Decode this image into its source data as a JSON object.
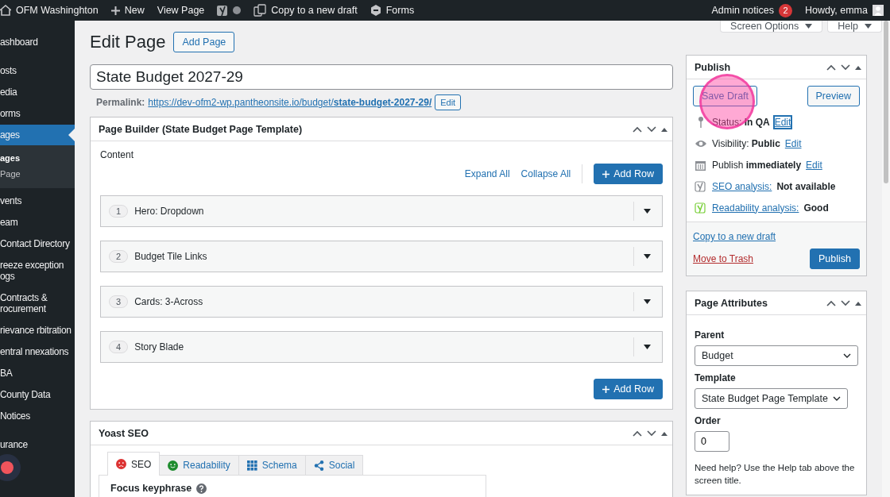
{
  "admin_bar": {
    "site": "OFM Washinghton",
    "new": "New",
    "view": "View Page",
    "copy": "Copy to a new draft",
    "forms": "Forms",
    "notices": "Admin notices",
    "notice_count": "2",
    "howdy": "Howdy, emma"
  },
  "sidebar": {
    "items": [
      {
        "label": "ashboard",
        "selected": false
      },
      {
        "label": "osts",
        "selected": false
      },
      {
        "label": "edia",
        "selected": false
      },
      {
        "label": "orms",
        "selected": false
      },
      {
        "label": "ages",
        "selected": true,
        "children": [
          {
            "label": "ages",
            "selected": true
          },
          {
            "label": "Page",
            "selected": false
          }
        ]
      },
      {
        "label": "vents",
        "selected": false
      },
      {
        "label": "eam",
        "selected": false
      },
      {
        "label": "Contact Directory",
        "selected": false
      },
      {
        "label": "reeze exception ogs",
        "selected": false
      },
      {
        "label": "Contracts & rocurement",
        "selected": false
      },
      {
        "label": "rievance rbitration",
        "selected": false
      },
      {
        "label": "entral nnexations",
        "selected": false
      },
      {
        "label": "BA",
        "selected": false
      },
      {
        "label": "County Data",
        "selected": false
      },
      {
        "label": "Notices",
        "selected": false
      },
      {
        "label": "urance",
        "selected": false
      }
    ]
  },
  "screen_options": [
    "Screen Options",
    "Help"
  ],
  "heading": "Edit Page",
  "add_page": "Add Page",
  "title_value": "State Budget 2027-29",
  "permalink": {
    "label": "Permalink:",
    "base": "https://dev-ofm2-wp.pantheonsite.io/budget/",
    "slug": "state-budget-2027-29/",
    "edit": "Edit"
  },
  "page_builder": {
    "title": "Page Builder (State Budget Page Template)",
    "content_label": "Content",
    "expand": "Expand All",
    "collapse": "Collapse All",
    "add_row_top": "Add Row",
    "add_row_bottom": "Add Row",
    "rows": [
      {
        "number": "1",
        "label": "Hero: Dropdown"
      },
      {
        "number": "2",
        "label": "Budget Tile Links"
      },
      {
        "number": "3",
        "label": "Cards: 3-Across"
      },
      {
        "number": "4",
        "label": "Story Blade"
      }
    ]
  },
  "yoast": {
    "title": "Yoast SEO",
    "tabs": [
      {
        "label": "SEO",
        "kind": "sad",
        "selected": true
      },
      {
        "label": "Readability",
        "kind": "smile",
        "selected": false
      },
      {
        "label": "Schema",
        "kind": "grid",
        "selected": false
      },
      {
        "label": "Social",
        "kind": "share",
        "selected": false
      }
    ],
    "focus_label": "Focus keyphrase"
  },
  "publish": {
    "title": "Publish",
    "save": "Save Draft",
    "preview": "Preview",
    "rows": [
      {
        "kind": "pin",
        "text": "Status: **In QA**",
        "link": "Edit",
        "focused": true
      },
      {
        "kind": "eye",
        "text": "Visibility: **Public**",
        "link": "Edit",
        "focused": false
      },
      {
        "kind": "calendar",
        "text": "Publish **immediately**",
        "link": "Edit",
        "focused": false
      },
      {
        "kind": "yoast-gray",
        "link": "SEO analysis:",
        "text": "**Not available**"
      },
      {
        "kind": "yoast-green",
        "link": "Readability analysis:",
        "text": "**Good**"
      }
    ],
    "copy": "Copy to a new draft",
    "trash": "Move to Trash",
    "publish": "Publish"
  },
  "attributes": {
    "title": "Page Attributes",
    "parent_label": "Parent",
    "parent": "Budget",
    "template_label": "Template",
    "template": "State Budget Page Template",
    "order_label": "Order",
    "order": "0",
    "help": "Need help? Use the Help tab above the screen title."
  }
}
